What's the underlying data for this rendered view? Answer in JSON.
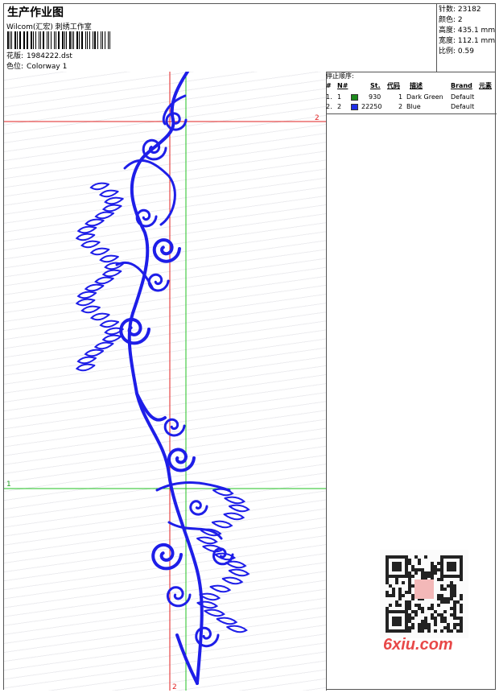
{
  "header": {
    "title": "生产作业图",
    "company": "Wilcom(汇宏) 刺绣工作室",
    "design_label": "花版:",
    "design_value": "1984222.dst",
    "colorway_label": "色位:",
    "colorway_value": "Colorway 1"
  },
  "stats": [
    {
      "label": "针数:",
      "value": "23182"
    },
    {
      "label": "颜色:",
      "value": "2"
    },
    {
      "label": "高度:",
      "value": "435.1 mm"
    },
    {
      "label": "宽度:",
      "value": "112.1 mm"
    },
    {
      "label": "比例:",
      "value": "0.59"
    }
  ],
  "stop_sequence": {
    "title": "停止顺序:",
    "columns": [
      "#",
      "N#",
      "St.",
      "代码",
      "描述",
      "Brand",
      "元素"
    ],
    "rows": [
      {
        "idx": "1.",
        "n": "1",
        "color": "#1c8a1c",
        "stitches": "930",
        "code": "1",
        "desc": "Dark Green",
        "brand": "Default"
      },
      {
        "idx": "2.",
        "n": "2",
        "color": "#1e2ee6",
        "stitches": "22250",
        "code": "2",
        "desc": "Blue",
        "brand": "Default"
      }
    ]
  },
  "markers": {
    "red_top": "2",
    "red_bottom": "2",
    "green_left": "1"
  },
  "watermark": "6xiu.com",
  "colors": {
    "embroidery_blue": "#1e1ee8",
    "guide_red": "#e02020",
    "guide_green": "#20c020"
  }
}
